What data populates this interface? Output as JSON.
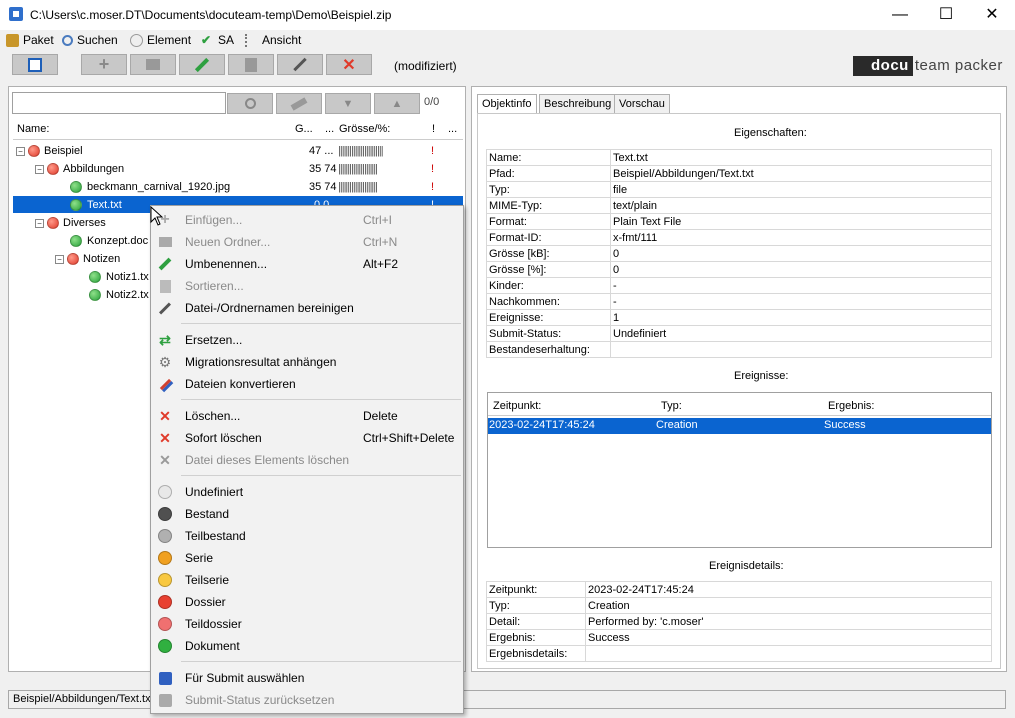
{
  "window": {
    "title": "C:\\Users\\c.moser.DT\\Documents\\docuteam-temp\\Demo\\Beispiel.zip",
    "minimize": "—",
    "maximize": "☐",
    "close": "✕"
  },
  "menu": [
    "Paket",
    "Suchen",
    "Element",
    "SA",
    "Ansicht"
  ],
  "toolbar": {
    "status": "(modifiziert)",
    "logo_dark": "docu",
    "logo_light": "team packer"
  },
  "search": {
    "counter": "0/0"
  },
  "tree": {
    "headers": [
      "Name:",
      "G...",
      "...",
      "Grösse/%:",
      "!",
      "..."
    ],
    "rows": [
      {
        "name": "Beispiel",
        "g": "47 ...",
        "bars": "||||||||||||||||||||||||",
        "flag": "!"
      },
      {
        "name": "Abbildungen",
        "g": "35 74",
        "bars": "|||||||||||||||||||||",
        "flag": "!"
      },
      {
        "name": "beckmann_carnival_1920.jpg",
        "g": "35 74",
        "bars": "|||||||||||||||||||||",
        "flag": "!"
      },
      {
        "name": "Text.txt",
        "g": "0  0",
        "bars": "",
        "flag": "!"
      },
      {
        "name": "Diverses",
        "g": "",
        "bars": "",
        "flag": ""
      },
      {
        "name": "Konzept.doc",
        "g": "",
        "bars": "",
        "flag": ""
      },
      {
        "name": "Notizen",
        "g": "",
        "bars": "",
        "flag": ""
      },
      {
        "name": "Notiz1.tx",
        "g": "",
        "bars": "",
        "flag": ""
      },
      {
        "name": "Notiz2.tx",
        "g": "",
        "bars": "",
        "flag": ""
      }
    ]
  },
  "tabs": [
    "Objektinfo",
    "Beschreibung",
    "Vorschau"
  ],
  "properties": {
    "title": "Eigenschaften:",
    "rows": [
      [
        "Name:",
        "Text.txt"
      ],
      [
        "Pfad:",
        "Beispiel/Abbildungen/Text.txt"
      ],
      [
        "Typ:",
        "file"
      ],
      [
        "MIME-Typ:",
        "text/plain"
      ],
      [
        "Format:",
        "Plain Text File"
      ],
      [
        "Format-ID:",
        "x-fmt/111"
      ],
      [
        "Grösse [kB]:",
        "0"
      ],
      [
        "Grösse [%]:",
        "0"
      ],
      [
        "Kinder:",
        "-"
      ],
      [
        "Nachkommen:",
        "-"
      ],
      [
        "Ereignisse:",
        "1"
      ],
      [
        "Submit-Status:",
        "Undefiniert"
      ],
      [
        "Bestandeserhaltung:",
        ""
      ]
    ]
  },
  "events": {
    "title": "Ereignisse:",
    "headers": [
      "Zeitpunkt:",
      "Typ:",
      "Ergebnis:"
    ],
    "row": [
      "2023-02-24T17:45:24",
      "Creation",
      "Success"
    ]
  },
  "event_details": {
    "title": "Ereignisdetails:",
    "rows": [
      [
        "Zeitpunkt:",
        "2023-02-24T17:45:24"
      ],
      [
        "Typ:",
        "Creation"
      ],
      [
        "Detail:",
        "Performed by: 'c.moser'"
      ],
      [
        "Ergebnis:",
        "Success"
      ],
      [
        "Ergebnisdetails:",
        ""
      ]
    ]
  },
  "statusbar": "Beispiel/Abbildungen/Text.txt",
  "context_menu": [
    {
      "label": "Einfügen...",
      "shortcut": "Ctrl+I",
      "disabled": true
    },
    {
      "label": "Neuen Ordner...",
      "shortcut": "Ctrl+N",
      "disabled": true
    },
    {
      "label": "Umbenennen...",
      "shortcut": "Alt+F2",
      "disabled": false
    },
    {
      "label": "Sortieren...",
      "shortcut": "",
      "disabled": true
    },
    {
      "label": "Datei-/Ordnernamen bereinigen",
      "shortcut": "",
      "disabled": false
    },
    {
      "label": "Ersetzen...",
      "shortcut": "",
      "disabled": false
    },
    {
      "label": "Migrationsresultat anhängen",
      "shortcut": "",
      "disabled": false
    },
    {
      "label": "Dateien konvertieren",
      "shortcut": "",
      "disabled": false
    },
    {
      "label": "Löschen...",
      "shortcut": "Delete",
      "disabled": false
    },
    {
      "label": "Sofort löschen",
      "shortcut": "Ctrl+Shift+Delete",
      "disabled": false
    },
    {
      "label": "Datei dieses Elements löschen",
      "shortcut": "",
      "disabled": true
    },
    {
      "label": "Undefiniert",
      "shortcut": "",
      "disabled": false,
      "color": "#e8e8e8"
    },
    {
      "label": "Bestand",
      "shortcut": "",
      "disabled": false,
      "color": "#505050"
    },
    {
      "label": "Teilbestand",
      "shortcut": "",
      "disabled": false,
      "color": "#b0b0b0"
    },
    {
      "label": "Serie",
      "shortcut": "",
      "disabled": false,
      "color": "#f0a020"
    },
    {
      "label": "Teilserie",
      "shortcut": "",
      "disabled": false,
      "color": "#f8c840"
    },
    {
      "label": "Dossier",
      "shortcut": "",
      "disabled": false,
      "color": "#e84030"
    },
    {
      "label": "Teildossier",
      "shortcut": "",
      "disabled": false,
      "color": "#f07070"
    },
    {
      "label": "Dokument",
      "shortcut": "",
      "disabled": false,
      "color": "#30b040"
    },
    {
      "label": "Für Submit auswählen",
      "shortcut": "",
      "disabled": false
    },
    {
      "label": "Submit-Status zurücksetzen",
      "shortcut": "",
      "disabled": true
    }
  ]
}
